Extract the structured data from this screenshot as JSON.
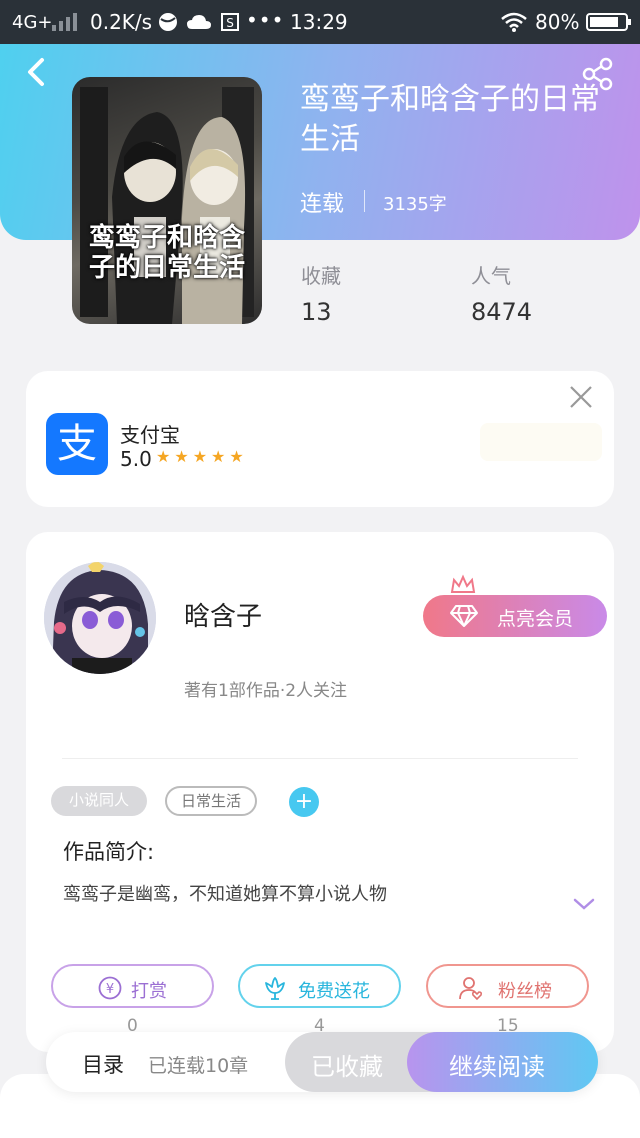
{
  "status_bar": {
    "network": "4G+",
    "speed": "0.2K/s",
    "time": "13:29",
    "more": "•••",
    "battery": "80%",
    "icons": [
      "signal-icon",
      "ball-icon",
      "cloud-icon",
      "s-app-icon",
      "wifi-icon",
      "battery-icon"
    ]
  },
  "header": {
    "icons": [
      "back-icon",
      "share-icon"
    ],
    "gradient": [
      "#4fd0ef",
      "#bf92ec"
    ]
  },
  "book": {
    "cover_title": "鸾鸾子和晗含子的日常生活",
    "title": "鸾鸾子和晗含子的日常生活",
    "status": "连载",
    "words": "3135字",
    "stats": [
      {
        "label": "收藏",
        "value": "13"
      },
      {
        "label": "人气",
        "value": "8474"
      }
    ]
  },
  "ad": {
    "app_name": "支付宝",
    "logo_char": "支",
    "rating": "5.0",
    "stars": "★★★★★",
    "icons": [
      "close-icon"
    ],
    "brand_color": "#1478ff"
  },
  "author": {
    "name": "晗含子",
    "info": "著有1部作品·2人关注",
    "vip_label": "点亮会员",
    "icons": [
      "crown-icon",
      "diamond-icon"
    ]
  },
  "tags": [
    "小说同人",
    "日常生活"
  ],
  "tag_add": "+",
  "intro": {
    "title": "作品简介:",
    "text": "鸾鸾子是幽鸾，不知道她算不算小说人物"
  },
  "actions": [
    {
      "label": "打赏",
      "count": "0",
      "icon": "yen-icon",
      "color": "#9b6fd3"
    },
    {
      "label": "免费送花",
      "count": "4",
      "icon": "flower-icon",
      "color": "#29b6dd"
    },
    {
      "label": "粉丝榜",
      "count": "15",
      "icon": "fans-icon",
      "color": "#e07370"
    }
  ],
  "bottom": {
    "toc_label": "目录",
    "toc_count": "已连载10章",
    "fav_label": "已收藏",
    "read_label": "继续阅读"
  }
}
